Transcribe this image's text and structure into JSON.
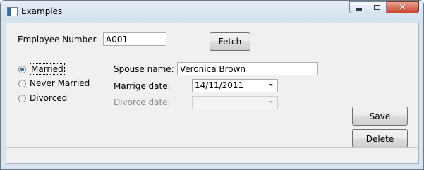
{
  "window": {
    "title": "Examples",
    "min_icon": "minimize-icon",
    "max_icon": "maximize-icon",
    "close_icon": "close-icon",
    "close_glyph": "✕"
  },
  "employee": {
    "label": "Employee Number",
    "value": "A001",
    "fetch_label": "Fetch"
  },
  "marital": {
    "options": [
      {
        "label": "Married",
        "selected": true
      },
      {
        "label": "Never Married",
        "selected": false
      },
      {
        "label": "Divorced",
        "selected": false
      }
    ]
  },
  "spouse": {
    "label": "Spouse name:",
    "value": "Veronica Brown"
  },
  "marriage_date": {
    "label": "Marrige date:",
    "value": "14/11/2011"
  },
  "divorce_date": {
    "label": "Divorce date:",
    "value": ""
  },
  "actions": {
    "save_label": "Save",
    "delete_label": "Delete"
  }
}
